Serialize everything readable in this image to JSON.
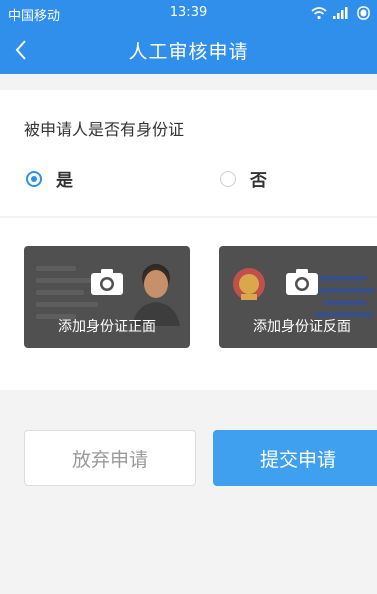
{
  "status_bar": {
    "carrier": "中国移动",
    "time": "13:39"
  },
  "nav": {
    "title": "人工审核申请",
    "back_icon": "chevron-left-icon"
  },
  "form": {
    "question": "被申请人是否有身份证",
    "options": [
      {
        "label": "是",
        "selected": true
      },
      {
        "label": "否",
        "selected": false
      }
    ]
  },
  "id_cards": {
    "front_label": "添加身份证正面",
    "back_label": "添加身份证反面",
    "icon": "camera-icon"
  },
  "actions": {
    "cancel_label": "放弃申请",
    "submit_label": "提交申请"
  },
  "colors": {
    "primary": "#2f8fea",
    "submit": "#40a0f0",
    "card_bg": "#505050"
  }
}
